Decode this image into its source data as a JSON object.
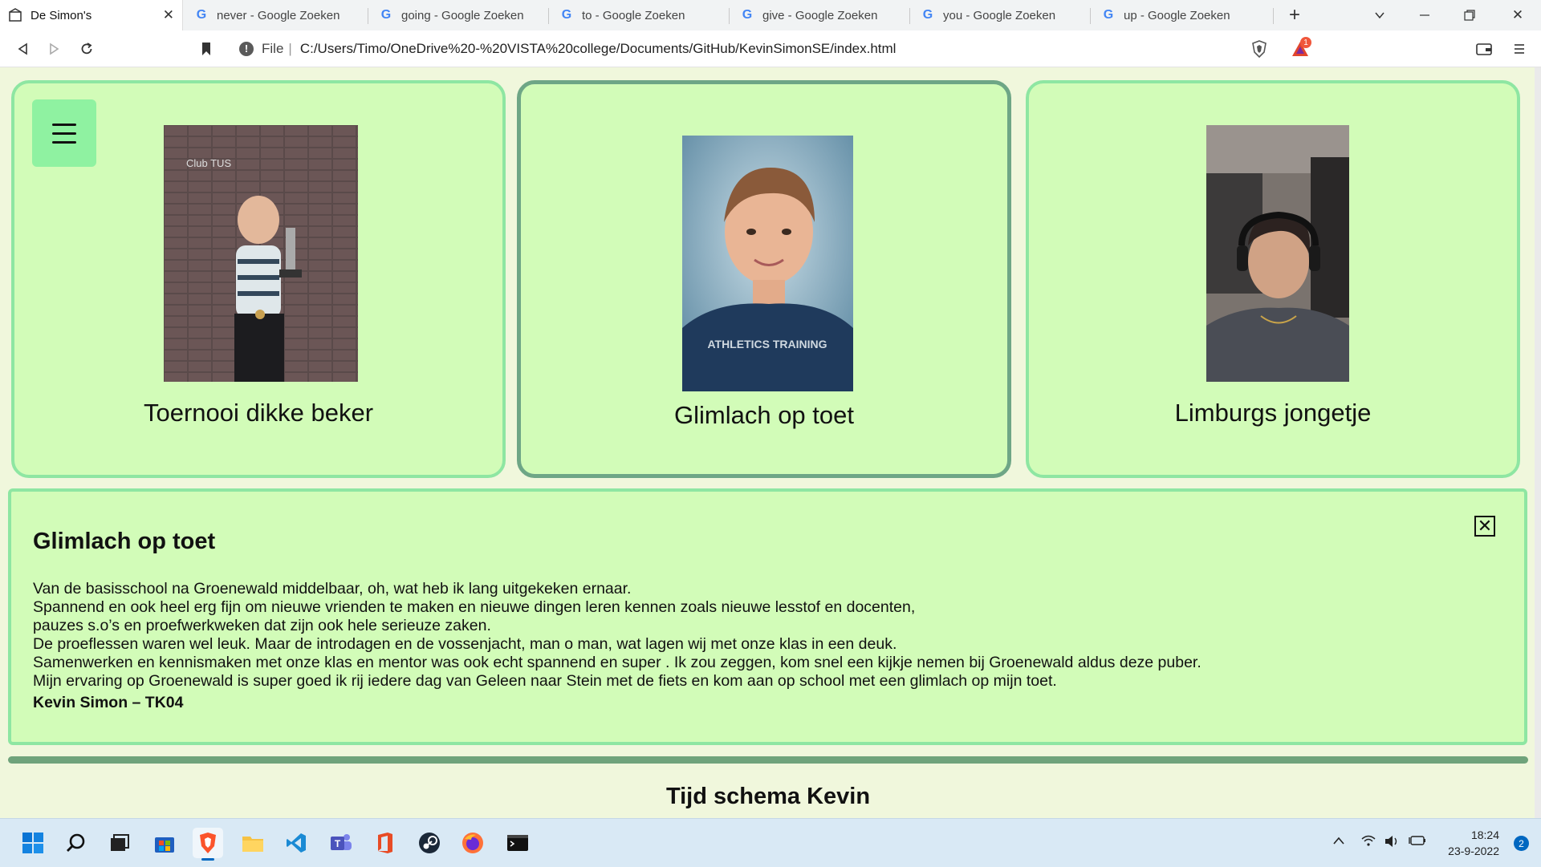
{
  "browser": {
    "tabs": [
      {
        "title": "De Simon's",
        "active": true
      },
      {
        "title": "never - Google Zoeken"
      },
      {
        "title": "going - Google Zoeken"
      },
      {
        "title": "to - Google Zoeken"
      },
      {
        "title": "give - Google Zoeken"
      },
      {
        "title": "you - Google Zoeken"
      },
      {
        "title": "up - Google Zoeken"
      }
    ],
    "address": {
      "scheme_label": "File",
      "separator": "|",
      "url": "C:/Users/Timo/OneDrive%20-%20VISTA%20college/Documents/GitHub/KevinSimonSE/index.html"
    },
    "brave_badge": "1"
  },
  "cards": [
    {
      "caption": "Toernooi dikke beker",
      "photo_desc": "boy holding trophy in front of brick wall",
      "chalk_text": "Club TUS"
    },
    {
      "caption": "Glimlach op toet",
      "photo_desc": "school portrait of smiling boy",
      "shirt_text": "ATHLETICS TRAINING"
    },
    {
      "caption": "Limburgs jongetje",
      "photo_desc": "teenager with headphones"
    }
  ],
  "selected_card": 1,
  "detail": {
    "title": "Glimlach op toet",
    "lines": [
      "Van de basisschool na Groenewald middelbaar, oh, wat heb ik lang uitgekeken ernaar.",
      "Spannend en ook heel erg fijn om nieuwe vrienden te maken en nieuwe dingen leren kennen zoals nieuwe lesstof en docenten,",
      "pauzes s.o’s en proefwerkweken dat zijn ook hele serieuze zaken.",
      "De proeflessen waren wel leuk. Maar de introdagen en de vossenjacht, man o man, wat lagen wij met onze klas in een deuk.",
      "Samenwerken en kennismaken met onze klas en mentor was ook echt spannend en super . Ik zou zeggen, kom snel een kijkje nemen bij Groenewald aldus deze puber.",
      "Mijn ervaring op Groenewald is super goed ik rij iedere dag van Geleen naar Stein met de fiets en kom aan op school met een glimlach op mijn toet."
    ],
    "signature": "Kevin Simon – TK04",
    "close_symbol": "✕"
  },
  "schedule": {
    "title": "Tijd schema Kevin"
  },
  "taskbar": {
    "apps": [
      "windows-start",
      "search",
      "task-view",
      "microsoft-store",
      "brave",
      "file-explorer",
      "vs-code",
      "teams",
      "office",
      "steam",
      "firefox",
      "terminal"
    ],
    "time": "18:24",
    "date": "23-9-2022",
    "notifications": "2"
  },
  "colors": {
    "page_bg": "#f0f7dc",
    "card_bg": "#d2fcb8",
    "card_border": "#8ee6a2",
    "selected_border": "#6ea686",
    "menu_button": "#8ff2a1",
    "divider": "#6fa37b"
  }
}
